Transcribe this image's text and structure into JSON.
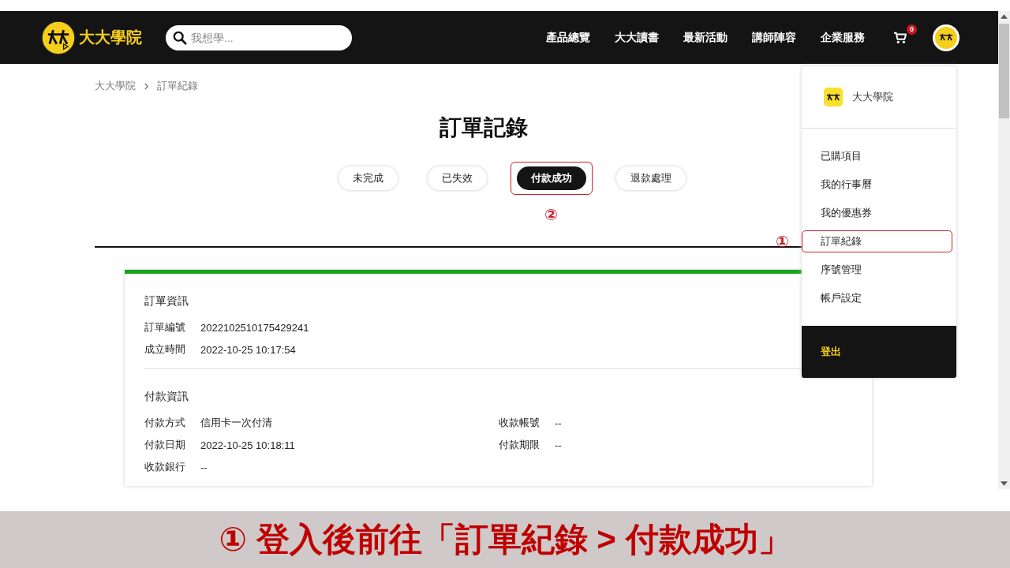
{
  "header": {
    "logo_text": "大大學院",
    "search": {
      "placeholder": "我想學..."
    },
    "nav": [
      "產品總覽",
      "大大讀書",
      "最新活動",
      "講師陣容",
      "企業服務"
    ],
    "cart_count": "0"
  },
  "breadcrumb": [
    "大大學院",
    "訂單紀錄"
  ],
  "page_title": "訂單記錄",
  "tabs": [
    {
      "label": "未完成",
      "selected": false,
      "highlighted": false
    },
    {
      "label": "已失效",
      "selected": false,
      "highlighted": false
    },
    {
      "label": "付款成功",
      "selected": true,
      "highlighted": true
    },
    {
      "label": "退款處理",
      "selected": false,
      "highlighted": false
    }
  ],
  "tab_annotation": "②",
  "order_card": {
    "sections": [
      {
        "title": "訂單資訊",
        "left": [
          {
            "label": "訂單編號",
            "value": "2022102510175429241"
          },
          {
            "label": "成立時間",
            "value": "2022-10-25 10:17:54"
          }
        ]
      },
      {
        "title": "付款資訊",
        "left": [
          {
            "label": "付款方式",
            "value": "信用卡一次付清"
          },
          {
            "label": "付款日期",
            "value": "2022-10-25 10:18:11"
          },
          {
            "label": "收款銀行",
            "value": "--"
          }
        ],
        "right": [
          {
            "label": "收款帳號",
            "value": "--"
          },
          {
            "label": "付款期限",
            "value": "--"
          }
        ]
      }
    ]
  },
  "user_menu": {
    "brand": "大大學院",
    "items": [
      {
        "label": "已購項目",
        "highlighted": false
      },
      {
        "label": "我的行事曆",
        "highlighted": false
      },
      {
        "label": "我的優惠券",
        "highlighted": false
      },
      {
        "label": "訂單紀錄",
        "highlighted": true
      },
      {
        "label": "序號管理",
        "highlighted": false
      },
      {
        "label": "帳戶設定",
        "highlighted": false
      }
    ],
    "logout": "登出",
    "annotation": "①"
  },
  "caption": "① 登入後前往「訂單紀錄 > 付款成功」"
}
